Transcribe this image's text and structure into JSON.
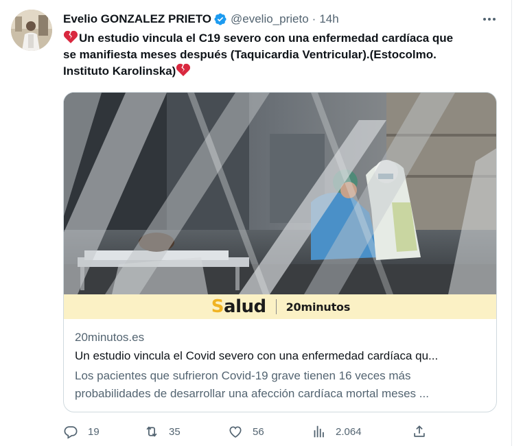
{
  "tweet": {
    "author_name": "Evelio GONZALEZ PRIETO",
    "handle": "@evelio_prieto",
    "separator": "·",
    "time": "14h",
    "text_line1": "Un estudio vincula el C19 severo con una enfermedad cardíaca que",
    "text_line2": "se manifiesta meses después (Taquicardia Ventricular).(Estocolmo.",
    "text_line3": "Instituto Karolinska)",
    "icons": {
      "verified": "verified-badge-icon",
      "broken_heart": "broken-heart-icon",
      "more": "more-icon"
    }
  },
  "card": {
    "banner_salud_first": "S",
    "banner_salud_rest": "alud",
    "banner_brand": "20minutos",
    "domain": "20minutos.es",
    "title": "Un estudio vincula el Covid severo con una enfermedad cardíaca qu...",
    "description_line1": "Los pacientes que sufrieron Covid-19 grave tienen 16 veces más",
    "description_line2": "probabilidades de desarrollar una afección cardíaca mortal meses ..."
  },
  "actions": {
    "replies": "19",
    "retweets": "35",
    "likes": "56",
    "views": "2.064"
  },
  "colors": {
    "verified": "#1d9bf0",
    "heart": "#d9283f",
    "muted": "#536471",
    "banner_bg": "#fbf1c5",
    "banner_accent": "#f0b323"
  }
}
